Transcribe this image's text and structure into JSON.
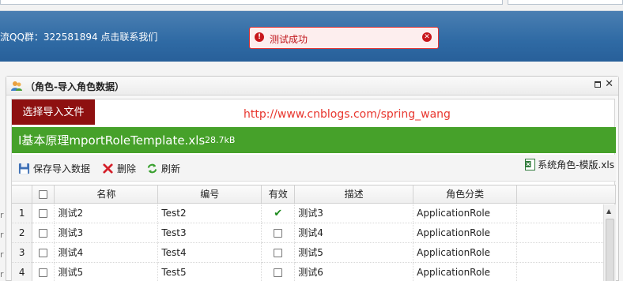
{
  "header": {
    "qq_text": "流QQ群：322581894 点击联系我们"
  },
  "toast": {
    "message": "测试成功"
  },
  "side_letters": [
    "r",
    "r",
    "r",
    "r"
  ],
  "dialog": {
    "title": "（角色-导入角色数据）",
    "select_file_label": "选择导入文件",
    "link_text": "http://www.cnblogs.com/spring_wang",
    "file": {
      "name": "I基本原理mportRoleTemplate.xls",
      "size": "28.7kB"
    },
    "toolbar": {
      "save_label": "保存导入数据",
      "delete_label": "删除",
      "refresh_label": "刷新",
      "template_label": "系统角色-模版.xls"
    },
    "grid": {
      "columns": [
        "",
        "",
        "名称",
        "编号",
        "有效",
        "描述",
        "角色分类"
      ],
      "rows": [
        {
          "num": "1",
          "name": "测试2",
          "code": "Test2",
          "valid": true,
          "desc": "测试3",
          "category": "ApplicationRole"
        },
        {
          "num": "2",
          "name": "测试3",
          "code": "Test3",
          "valid": false,
          "desc": "测试4",
          "category": "ApplicationRole"
        },
        {
          "num": "3",
          "name": "测试4",
          "code": "Test4",
          "valid": false,
          "desc": "测试5",
          "category": "ApplicationRole"
        },
        {
          "num": "4",
          "name": "测试5",
          "code": "Test5",
          "valid": false,
          "desc": "测试6",
          "category": "ApplicationRole"
        }
      ]
    }
  },
  "colors": {
    "header_blue": "#2f6aa4",
    "toast_red": "#c8161b",
    "select_button": "#8e1010",
    "file_bar_green": "#46a12a",
    "link_red": "#e8362e"
  }
}
